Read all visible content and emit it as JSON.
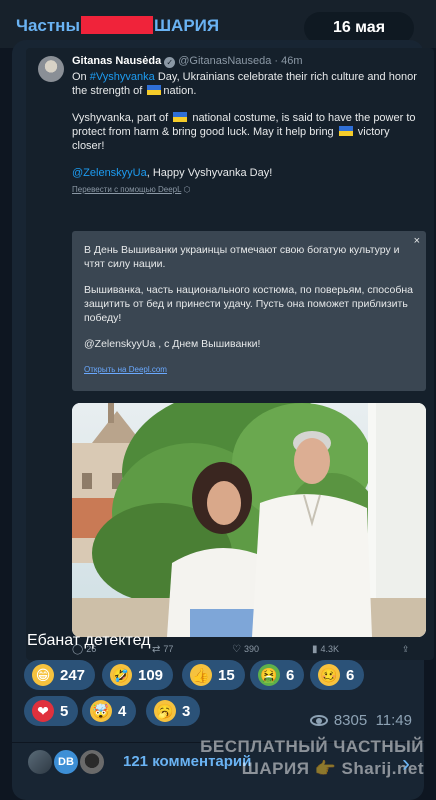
{
  "header": {
    "channel_prefix": "Частны",
    "channel_suffix": "ШАРИЯ",
    "date": "16 мая"
  },
  "tweet": {
    "author_name": "Gitanas Nausėda",
    "handle_time": "@GitanasNauseda · 46m",
    "line1_a": "On ",
    "hashtag": "#Vyshyvanka",
    "line1_b": " Day, Ukrainians celebrate their rich culture and honor the strength of ",
    "line1_c": "nation.",
    "para2_a": "Vyshyvanka, part of ",
    "para2_b": " national costume, is said to have the power to protect from harm & bring good luck. May it help bring ",
    "para2_c": " victory closer!",
    "mention": "@ZelenskyyUa",
    "para3_rest": ", Happy Vyshyvanka Day!",
    "translate_link": "Перевести с помощью DeepL"
  },
  "translation": {
    "para1": "В День Вышиванки украинцы отмечают свою богатую культуру и чтят силу нации.",
    "para2": "Вышиванка, часть национального костюма, по поверьям, способна защитить от бед и принести удачу. Пусть она поможет приблизить победу!",
    "para3": "@ZelenskyyUa , с Днем Вышиванки!",
    "open_link": "Открыть на Deepl.com",
    "close": "×"
  },
  "tweet_stats": {
    "replies": "26",
    "retweets": "77",
    "likes": "390",
    "views": "4.3K"
  },
  "message": {
    "caption": "Ебанат детектед",
    "views": "8305",
    "time": "11:49"
  },
  "reactions": [
    {
      "emoji": "😁",
      "count": "247",
      "color": "#f6c23e"
    },
    {
      "emoji": "🤣",
      "count": "109",
      "color": "#f6c23e"
    },
    {
      "emoji": "👍",
      "count": "15",
      "color": "#f6c23e"
    },
    {
      "emoji": "🤮",
      "count": "6",
      "color": "#5fb14a"
    },
    {
      "emoji": "🥴",
      "count": "6",
      "color": "#f6c23e"
    },
    {
      "emoji": "❤",
      "count": "5",
      "color": "#e0313d"
    },
    {
      "emoji": "🤯",
      "count": "4",
      "color": "#f6c23e"
    },
    {
      "emoji": "🥱",
      "count": "3",
      "color": "#f6c23e"
    }
  ],
  "comments": {
    "label": "121 комментарий",
    "avatar_initials": "DB"
  },
  "watermark": {
    "line1": "БЕСПЛАТНЫЙ ЧАСТНЫЙ",
    "line2": "ШАРИЯ 👉 Sharij.net"
  },
  "colors": {
    "accent": "#6ab3f3",
    "bubble": "#182533",
    "reaction_pill": "#2b5278",
    "redaction": "#f0233a"
  }
}
